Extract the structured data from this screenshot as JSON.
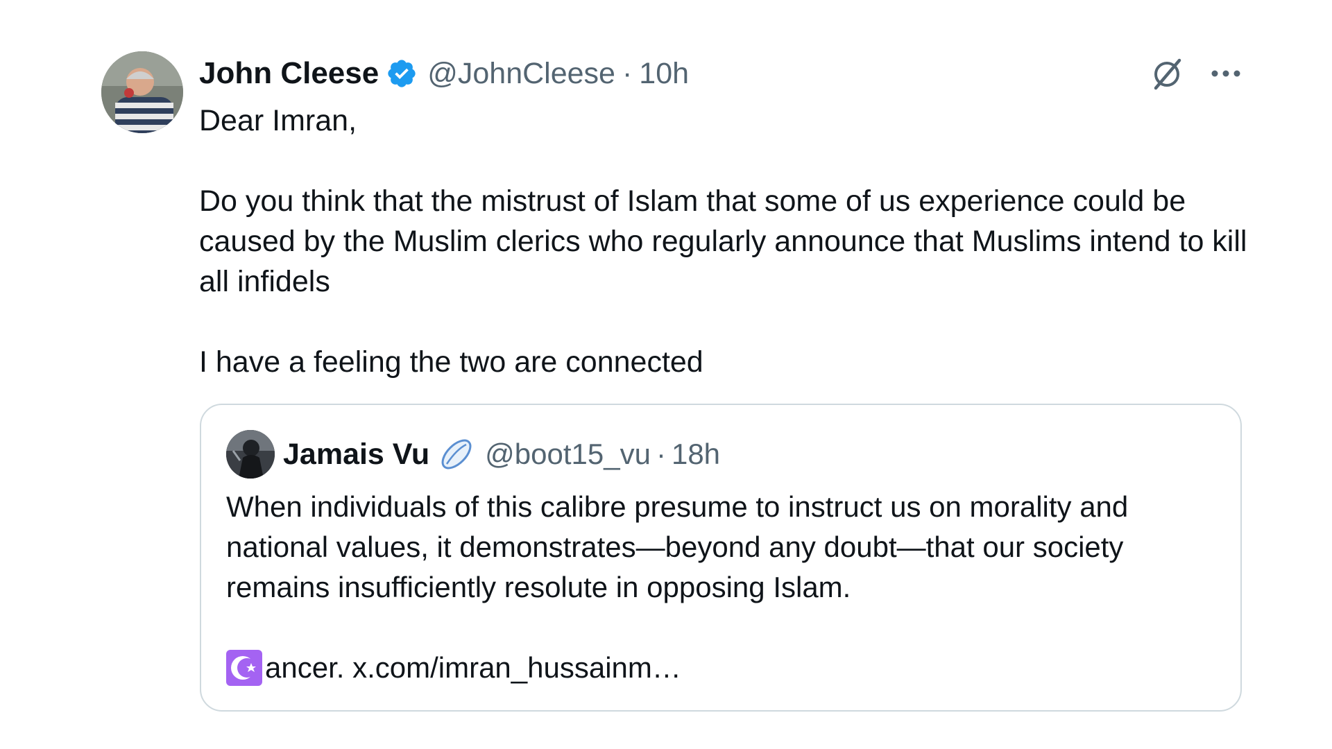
{
  "tweet": {
    "author": {
      "display_name": "John Cleese",
      "handle": "@JohnCleese",
      "verified": true
    },
    "separator": "·",
    "time": "10h",
    "icons": {
      "avatar": "avatar-photo",
      "verified": "verified-badge-icon",
      "grok": "grok-icon",
      "more": "more-icon"
    },
    "body": {
      "greeting": "Dear Imran,",
      "paragraph": "Do you think that the mistrust of Islam that some of us experience could be caused by the Muslim clerics who regularly announce that Muslims intend to kill all infidels",
      "closing": "I have a feeling the two are connected"
    }
  },
  "quote": {
    "author": {
      "display_name": "Jamais Vu",
      "handle": "@boot15_vu"
    },
    "separator": "·",
    "time": "18h",
    "icons": {
      "avatar": "avatar-photo",
      "emoji": "rugby-ball-icon",
      "crescent": "star-and-crescent-icon"
    },
    "text": "When individuals of this calibre presume to instruct us on morality and national values, it demonstrates—beyond any doubt—that our society remains insufficiently resolute in opposing Islam.",
    "link_text": "ancer. x.com/imran_hussainm…"
  },
  "colors": {
    "text_primary": "#0f1419",
    "text_secondary": "#536471",
    "verified_blue": "#1d9bf0",
    "border": "#cfd9de",
    "crescent_purple": "#a463f2"
  }
}
